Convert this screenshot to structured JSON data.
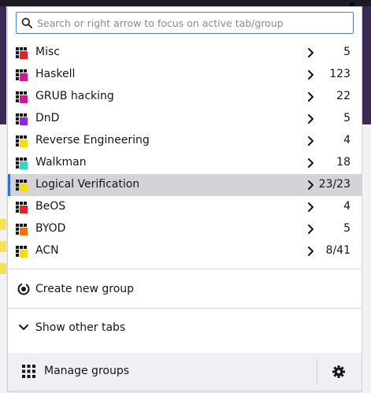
{
  "search": {
    "placeholder": "Search or right arrow to focus on active tab/group"
  },
  "groups": [
    {
      "name": "Misc",
      "count": "5",
      "color": "#e0232b",
      "active": false
    },
    {
      "name": "Haskell",
      "count": "123",
      "color": "#d4159a",
      "active": false
    },
    {
      "name": "GRUB hacking",
      "count": "22",
      "color": "#d4159a",
      "active": false
    },
    {
      "name": "DnD",
      "count": "5",
      "color": "#9b22e0",
      "active": false
    },
    {
      "name": "Reverse Engineering",
      "count": "4",
      "color": "#f4e000",
      "active": false
    },
    {
      "name": "Walkman",
      "count": "18",
      "color": "#2cd8c8",
      "active": false
    },
    {
      "name": "Logical Verification",
      "count": "23/23",
      "color": "#f4e000",
      "active": true
    },
    {
      "name": "BeOS",
      "count": "4",
      "color": "#e0232b",
      "active": false
    },
    {
      "name": "BYOD",
      "count": "5",
      "color": "#f07014",
      "active": false
    },
    {
      "name": "ACN",
      "count": "8/41",
      "color": "#f4e000",
      "active": false
    }
  ],
  "actions": {
    "create_group": "Create new group",
    "show_other_tabs": "Show other tabs"
  },
  "footer": {
    "manage_groups": "Manage groups"
  },
  "colors": {
    "accent": "#2f6ee0",
    "active_row": "#d4d4d8",
    "footer_bg": "#f0f0f4"
  },
  "icons": {
    "search": "search-icon",
    "group": "group-grid-icon",
    "chevron": "chevron-right-icon",
    "create": "create-group-icon",
    "expand": "chevron-down-icon",
    "manage": "grid-icon",
    "settings": "gear-icon"
  }
}
